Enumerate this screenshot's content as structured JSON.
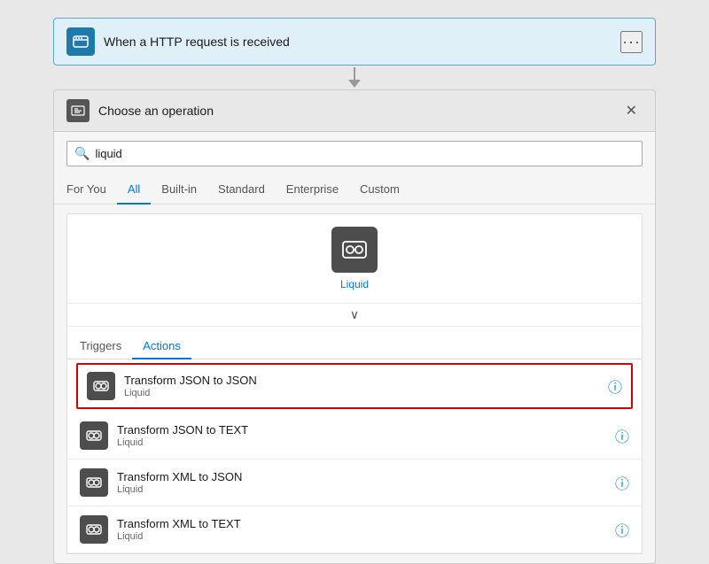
{
  "trigger": {
    "title": "When a HTTP request is received",
    "dots_label": "···"
  },
  "panel": {
    "title": "Choose an operation",
    "close_label": "✕"
  },
  "search": {
    "placeholder": "liquid",
    "value": "liquid",
    "icon_label": "search"
  },
  "tabs": [
    {
      "id": "for-you",
      "label": "For You",
      "active": false
    },
    {
      "id": "all",
      "label": "All",
      "active": true
    },
    {
      "id": "built-in",
      "label": "Built-in",
      "active": false
    },
    {
      "id": "standard",
      "label": "Standard",
      "active": false
    },
    {
      "id": "enterprise",
      "label": "Enterprise",
      "active": false
    },
    {
      "id": "custom",
      "label": "Custom",
      "active": false
    }
  ],
  "connector": {
    "name": "Liquid",
    "icon_alt": "liquid-connector"
  },
  "inner_tabs": [
    {
      "id": "triggers",
      "label": "Triggers",
      "active": false
    },
    {
      "id": "actions",
      "label": "Actions",
      "active": true
    }
  ],
  "actions": [
    {
      "id": "transform-json-json",
      "name": "Transform JSON to JSON",
      "sub": "Liquid",
      "selected": true
    },
    {
      "id": "transform-json-text",
      "name": "Transform JSON to TEXT",
      "sub": "Liquid",
      "selected": false
    },
    {
      "id": "transform-xml-json",
      "name": "Transform XML to JSON",
      "sub": "Liquid",
      "selected": false
    },
    {
      "id": "transform-xml-text",
      "name": "Transform XML to TEXT",
      "sub": "Liquid",
      "selected": false
    }
  ],
  "colors": {
    "accent": "#0078d4",
    "trigger_bg": "#e0f0f8",
    "trigger_border": "#5ba7c8",
    "selected_border": "#d00000"
  }
}
